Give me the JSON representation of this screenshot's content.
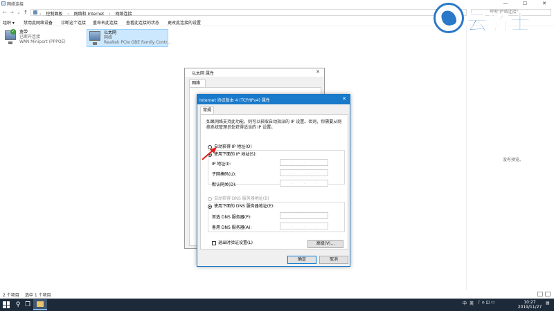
{
  "window": {
    "title": "网络连接",
    "minimize": "—",
    "maximize": "☐",
    "close": "✕"
  },
  "address_bar": {
    "back": "←",
    "forward": "→",
    "dropdown": "⌄",
    "up": "↑",
    "crumbs": [
      "控制面板",
      "网络和 Internet",
      "网络连接"
    ],
    "separator": "›",
    "search_placeholder": "搜索\"网络连接\""
  },
  "toolbar": {
    "items": [
      "组织 ▾",
      "禁用此网络设备",
      "诊断这个连接",
      "重命名此连接",
      "查看此连接的状态",
      "更改此连接的设置"
    ]
  },
  "connections": [
    {
      "name": "宽带",
      "status": "已断开连接",
      "device": "WAN Miniport (PPPOE)"
    },
    {
      "name": "以太网",
      "status": "网络",
      "device": "Realtek PCIe GBE Family Contr..."
    }
  ],
  "details_pane": {
    "message": "没有预览。"
  },
  "status_bar": {
    "item_count": "2 个项目",
    "selected": "选中 1 个项目"
  },
  "back_dialog": {
    "title": "以太网 属性",
    "tab": "网络",
    "close": "✕"
  },
  "ipv4_dialog": {
    "title": "Internet 协议版本 4 (TCP/IPv4) 属性",
    "close": "✕",
    "tab": "常规",
    "description": "如果网络支持此功能，则可以获取自动指派的 IP 设置。否则，你需要从网络系统管理员处获得适当的 IP 设置。",
    "ip_auto": "自动获得 IP 地址(O)",
    "ip_manual": "使用下面的 IP 地址(S):",
    "ip_address_label": "IP 地址(I):",
    "subnet_label": "子网掩码(U):",
    "gateway_label": "默认网关(D):",
    "dns_auto": "自动获得 DNS 服务器地址(B)",
    "dns_manual": "使用下面的 DNS 服务器地址(E):",
    "dns_preferred_label": "首选 DNS 服务器(P):",
    "dns_alternate_label": "备用 DNS 服务器(A):",
    "validate_on_exit": "退出时验证设置(L)",
    "advanced_button": "高级(V)...",
    "ok_button": "确定",
    "cancel_button": "取消",
    "ip_dots": "."
  },
  "taskbar": {
    "search_icon": "⚲",
    "task_view_icon": "❐",
    "tray_ime": "中",
    "tray_lang": "英",
    "tray_icons": "♪ ⌂ ◫ ▭",
    "time": "10:27",
    "date": "2019/11/27"
  },
  "logo": {
    "text": "云骑士"
  },
  "colors": {
    "title_accent": "#1979ca",
    "selection": "#cce8ff",
    "taskbar": "#1c2a3a",
    "logo": "#2a78c8"
  }
}
